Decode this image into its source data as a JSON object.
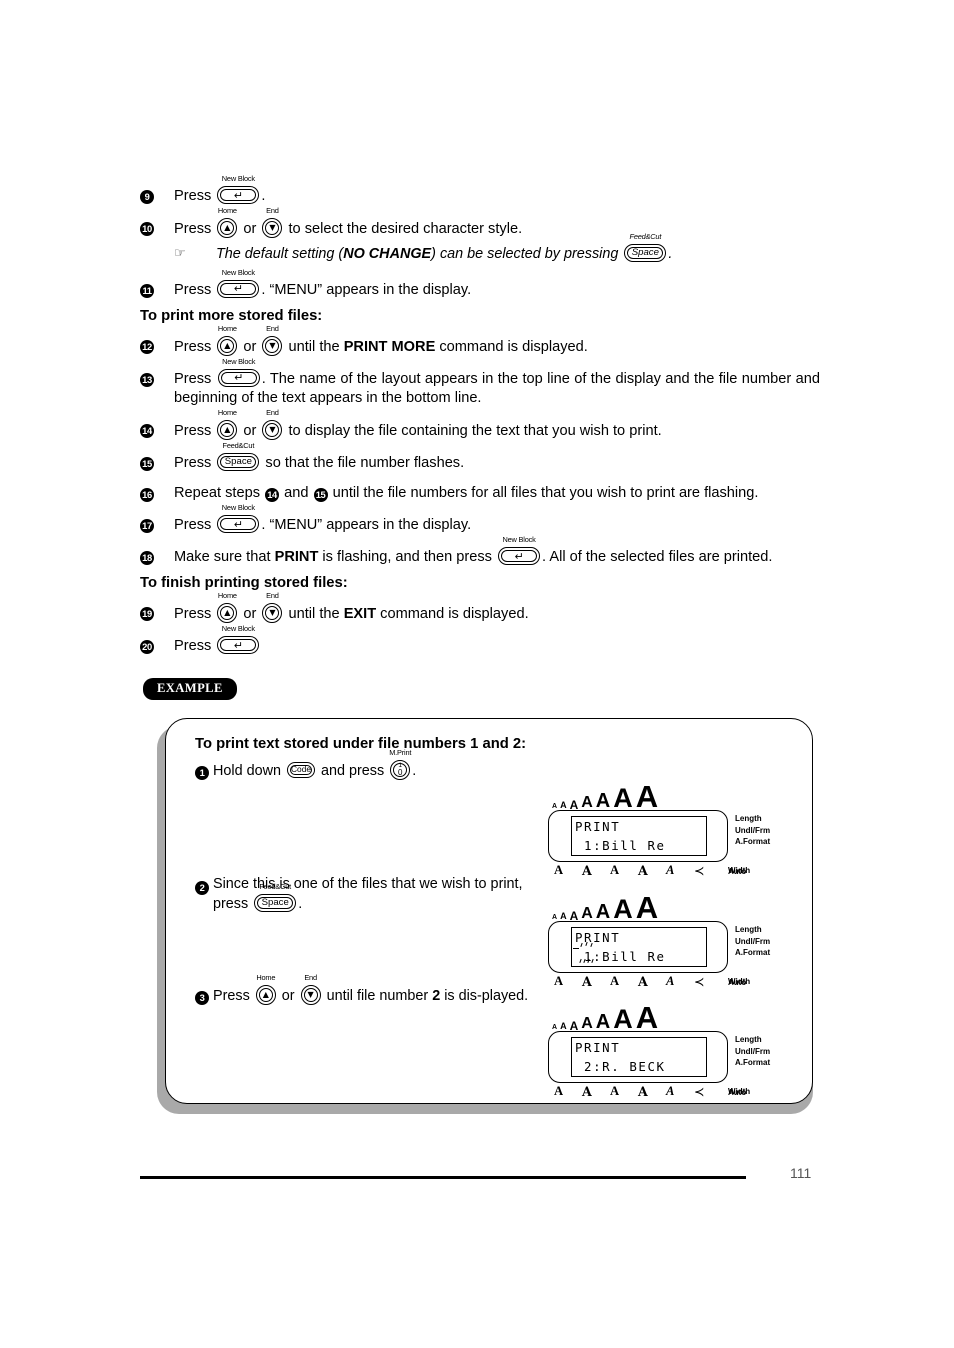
{
  "document": {
    "page_number": "111"
  },
  "keys": {
    "new_block": {
      "top_label": "New Block",
      "glyph": "↵",
      "name": "new-block-key"
    },
    "home": {
      "top_label": "Home",
      "glyph": "▲",
      "name": "home-up-arrow-key"
    },
    "end": {
      "top_label": "End",
      "glyph": "▼",
      "name": "end-down-arrow-key"
    },
    "space": {
      "top_label": "Feed&Cut",
      "glyph": "Space",
      "name": "space-key"
    },
    "code": {
      "top_label": "",
      "glyph": "Code",
      "name": "code-key"
    },
    "mprint": {
      "top_label": "M.Print",
      "glyph_top": "1",
      "glyph_bottom": "0",
      "name": "m-print-number-key"
    }
  },
  "steps": [
    {
      "num": "9",
      "parts": [
        {
          "type": "text",
          "value": "Press "
        },
        {
          "type": "key",
          "key": "new_block"
        },
        {
          "type": "text",
          "value": "."
        }
      ]
    },
    {
      "num": "10",
      "parts": [
        {
          "type": "text",
          "value": "Press "
        },
        {
          "type": "key",
          "key": "home"
        },
        {
          "type": "text",
          "value": " or "
        },
        {
          "type": "key",
          "key": "end"
        },
        {
          "type": "text",
          "value": " to select the desired character style."
        }
      ]
    },
    {
      "num": "11",
      "parts": [
        {
          "type": "text",
          "value": "Press "
        },
        {
          "type": "key",
          "key": "new_block"
        },
        {
          "type": "text",
          "value": ". “MENU” appears in the display."
        }
      ]
    },
    {
      "num": "12",
      "parts": [
        {
          "type": "text",
          "value": "Press "
        },
        {
          "type": "key",
          "key": "home"
        },
        {
          "type": "text",
          "value": " or "
        },
        {
          "type": "key",
          "key": "end"
        },
        {
          "type": "text",
          "value": " until the "
        },
        {
          "type": "bold",
          "value": "PRINT MORE"
        },
        {
          "type": "text",
          "value": " command is displayed."
        }
      ]
    },
    {
      "num": "13",
      "parts": [
        {
          "type": "text",
          "value": "Press "
        },
        {
          "type": "key",
          "key": "new_block"
        },
        {
          "type": "text",
          "value": ". The name of the layout appears in the top line of the display and the file number and beginning of the text appears in the bottom line."
        }
      ]
    },
    {
      "num": "14",
      "parts": [
        {
          "type": "text",
          "value": "Press "
        },
        {
          "type": "key",
          "key": "home"
        },
        {
          "type": "text",
          "value": " or "
        },
        {
          "type": "key",
          "key": "end"
        },
        {
          "type": "text",
          "value": " to display the file containing the text that you wish to print."
        }
      ]
    },
    {
      "num": "15",
      "parts": [
        {
          "type": "text",
          "value": "Press "
        },
        {
          "type": "key",
          "key": "space"
        },
        {
          "type": "text",
          "value": " so that the file number flashes."
        }
      ]
    },
    {
      "num": "16",
      "parts": [
        {
          "type": "text",
          "value": "Repeat steps "
        },
        {
          "type": "bullet",
          "value": "14"
        },
        {
          "type": "text",
          "value": " and "
        },
        {
          "type": "bullet",
          "value": "15"
        },
        {
          "type": "text",
          "value": " until the file numbers for all files that you wish to print are flashing."
        }
      ]
    },
    {
      "num": "17",
      "parts": [
        {
          "type": "text",
          "value": "Press "
        },
        {
          "type": "key",
          "key": "new_block"
        },
        {
          "type": "text",
          "value": ". “MENU” appears in the display."
        }
      ]
    },
    {
      "num": "18",
      "parts": [
        {
          "type": "text",
          "value": "Make sure that "
        },
        {
          "type": "bold",
          "value": "PRINT"
        },
        {
          "type": "text",
          "value": " is flashing, and then press "
        },
        {
          "type": "key",
          "key": "new_block"
        },
        {
          "type": "text",
          "value": ". All of the selected files are printed."
        }
      ]
    },
    {
      "num": "19",
      "parts": [
        {
          "type": "text",
          "value": "Press "
        },
        {
          "type": "key",
          "key": "home"
        },
        {
          "type": "text",
          "value": " or "
        },
        {
          "type": "key",
          "key": "end"
        },
        {
          "type": "text",
          "value": " until the "
        },
        {
          "type": "bold",
          "value": "EXIT"
        },
        {
          "type": "text",
          "value": " command is displayed."
        }
      ]
    },
    {
      "num": "20",
      "parts": [
        {
          "type": "text",
          "value": "Press "
        },
        {
          "type": "key",
          "key": "new_block"
        }
      ]
    }
  ],
  "note": {
    "icon": "pointing-hand",
    "icon_glyph": "☞",
    "text_before": "The default setting (",
    "text_bold": "NO CHANGE",
    "text_middle": ") can be selected by pressing ",
    "text_after": "."
  },
  "headings": {
    "print_more": "To print more stored files:",
    "finish_printing": "To finish printing stored files:"
  },
  "example": {
    "badge": "EXAMPLE",
    "title": "To print text stored under file numbers 1 and 2:",
    "steps": [
      {
        "num": "1",
        "parts": [
          {
            "type": "text",
            "value": "Hold down "
          },
          {
            "type": "key",
            "key": "code"
          },
          {
            "type": "text",
            "value": " and press "
          },
          {
            "type": "key",
            "key": "mprint"
          },
          {
            "type": "text",
            "value": "."
          }
        ]
      },
      {
        "num": "2",
        "parts": [
          {
            "type": "text",
            "value": "Since this is one of the files that we wish to print, press "
          },
          {
            "type": "key",
            "key": "space"
          },
          {
            "type": "text",
            "value": "."
          }
        ]
      },
      {
        "num": "3",
        "parts": [
          {
            "type": "text",
            "value": "Press "
          },
          {
            "type": "key",
            "key": "home"
          },
          {
            "type": "text",
            "value": " or "
          },
          {
            "type": "key",
            "key": "end"
          },
          {
            "type": "text",
            "value": " until file number "
          },
          {
            "type": "bold",
            "value": "2"
          },
          {
            "type": "text",
            "value": " is dis-played."
          }
        ]
      }
    ],
    "displays": [
      {
        "id": "lcd-1",
        "size_indicators": [
          "A",
          "A",
          "A",
          "A",
          "A",
          "A",
          "A"
        ],
        "auto_label": "Auto",
        "line1": "PRINT",
        "line2": " 1:Bill Re",
        "flashing": false,
        "side_labels": [
          "Length",
          "Undl/Frm",
          "A.Format"
        ],
        "bottom_indicators": [
          "A",
          "A",
          "A",
          "A",
          "A",
          "≺"
        ],
        "width_label": "Width"
      },
      {
        "id": "lcd-2",
        "size_indicators": [
          "A",
          "A",
          "A",
          "A",
          "A",
          "A",
          "A"
        ],
        "auto_label": "Auto",
        "line1": "PRINT",
        "line2": " 1:Bill Re",
        "flashing": true,
        "side_labels": [
          "Length",
          "Undl/Frm",
          "A.Format"
        ],
        "bottom_indicators": [
          "A",
          "A",
          "A",
          "A",
          "A",
          "≺"
        ],
        "width_label": "Width"
      },
      {
        "id": "lcd-3",
        "size_indicators": [
          "A",
          "A",
          "A",
          "A",
          "A",
          "A",
          "A"
        ],
        "auto_label": "Auto",
        "line1": "PRINT",
        "line2": " 2:R. BECK",
        "flashing": false,
        "side_labels": [
          "Length",
          "Undl/Frm",
          "A.Format"
        ],
        "bottom_indicators": [
          "A",
          "A",
          "A",
          "A",
          "A",
          "≺"
        ],
        "width_label": "Width"
      }
    ]
  }
}
